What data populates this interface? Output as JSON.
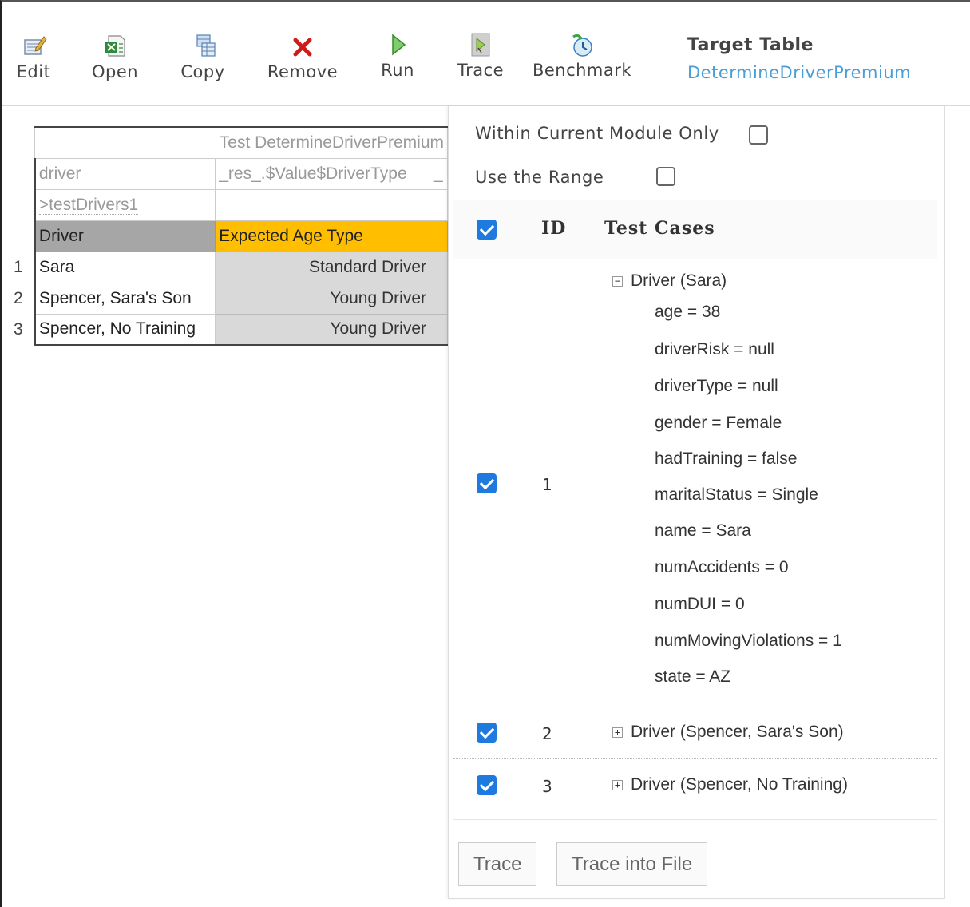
{
  "toolbar": {
    "edit": "Edit",
    "open": "Open",
    "copy": "Copy",
    "remove": "Remove",
    "run": "Run",
    "trace": "Trace",
    "benchmark": "Benchmark",
    "target_label": "Target Table",
    "target_value": "DetermineDriverPremium"
  },
  "grid": {
    "title": "Test DetermineDriverPremium",
    "col_driver": "driver",
    "col_res": "_res_.$Value$DriverType",
    "col_extra": "_",
    "ref": ">testDrivers1",
    "h_driver": "Driver",
    "h_age": "Expected Age Type",
    "rows": [
      {
        "num": "1",
        "name": "Sara",
        "value": "Standard Driver"
      },
      {
        "num": "2",
        "name": "Spencer, Sara's Son",
        "value": "Young Driver"
      },
      {
        "num": "3",
        "name": "Spencer, No Training",
        "value": "Young Driver"
      }
    ]
  },
  "panel": {
    "opt_module": "Within Current Module Only",
    "opt_range": "Use the Range",
    "opt_module_checked": false,
    "opt_range_checked": false,
    "col_id": "ID",
    "col_cases": "Test Cases",
    "cases": [
      {
        "id": "1",
        "label": "Driver (Sara)",
        "expanded": true,
        "checked": true,
        "props": [
          "age = 38",
          "driverRisk = null",
          "driverType = null",
          "gender = Female",
          "hadTraining = false",
          "maritalStatus = Single",
          "name = Sara",
          "numAccidents = 0",
          "numDUI = 0",
          "numMovingViolations = 1",
          "state = AZ"
        ]
      },
      {
        "id": "2",
        "label": "Driver (Spencer, Sara's Son)",
        "expanded": false,
        "checked": true
      },
      {
        "id": "3",
        "label": "Driver (Spencer, No Training)",
        "expanded": false,
        "checked": true
      }
    ],
    "btn_trace": "Trace",
    "btn_trace_file": "Trace into File"
  },
  "colors": {
    "accent_blue": "#1f7ae0",
    "link_blue": "#4a9ed6",
    "header_orange": "#ffbf00",
    "header_gray": "#a6a6a6"
  }
}
